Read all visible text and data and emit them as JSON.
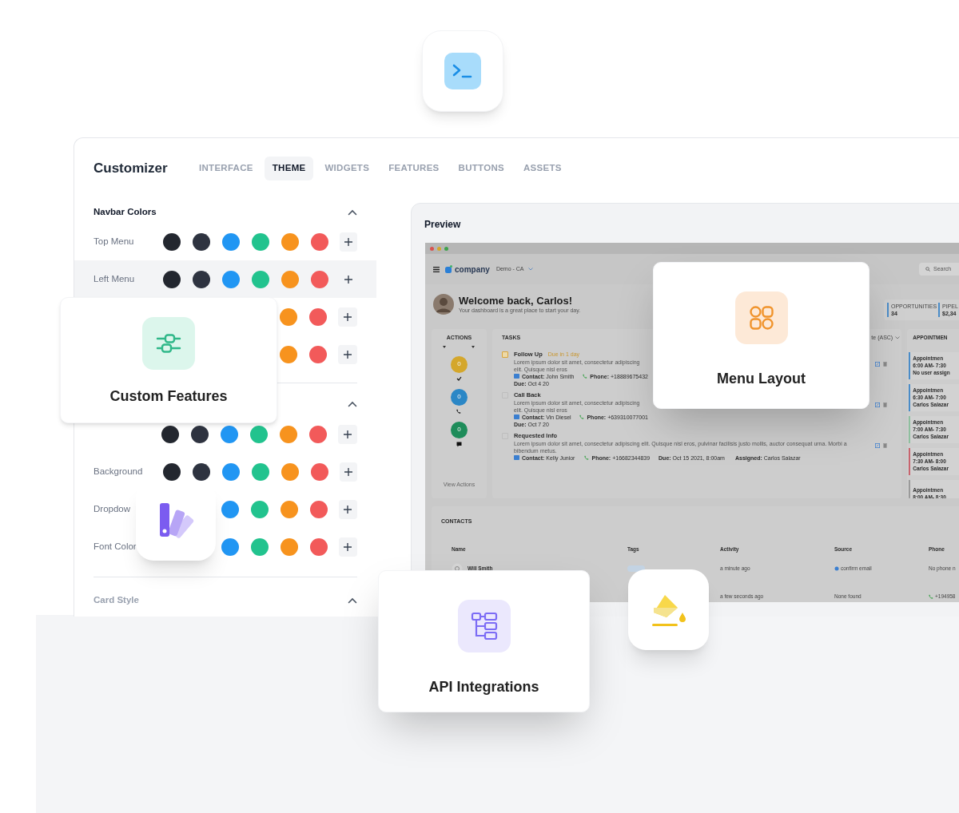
{
  "customizer": {
    "title": "Customizer",
    "tabs": [
      {
        "label": "INTERFACE",
        "selected": false
      },
      {
        "label": "THEME",
        "selected": true
      },
      {
        "label": "WIDGETS",
        "selected": false
      },
      {
        "label": "FEATURES",
        "selected": false
      },
      {
        "label": "BUTTONS",
        "selected": false
      },
      {
        "label": "ASSETS",
        "selected": false
      }
    ]
  },
  "sections": [
    {
      "title": "Navbar Colors",
      "expanded": true,
      "rows": [
        {
          "label": "Top Menu",
          "selected": false,
          "swatches": [
            {
              "color": "#23272f"
            },
            {
              "color": "#2e3340"
            },
            {
              "color": "#2196f3"
            },
            {
              "color": "#22c38e"
            },
            {
              "color": "#f7931e"
            },
            {
              "color": "#f25a5a"
            }
          ]
        },
        {
          "label": "Left Menu",
          "selected": true,
          "swatches": [
            {
              "color": "#23272f"
            },
            {
              "color": "#2e3340"
            },
            {
              "color": "#2196f3"
            },
            {
              "color": "#22c38e"
            },
            {
              "color": "#f7931e"
            },
            {
              "color": "#f25a5a"
            }
          ]
        },
        {
          "selected": false,
          "swatches": [
            {
              "color": "#f7931e"
            },
            {
              "color": "#f25a5a"
            }
          ]
        },
        {
          "selected": false,
          "swatches": [
            {
              "color": "#f7931e"
            },
            {
              "color": "#f25a5a"
            }
          ]
        }
      ]
    },
    {
      "expanded": true,
      "rows": [
        {
          "selected": false,
          "swatches": [
            {
              "color": "#23272f"
            },
            {
              "color": "#2e3340"
            },
            {
              "color": "#2196f3"
            },
            {
              "color": "#22c38e"
            },
            {
              "color": "#f7931e"
            },
            {
              "color": "#f25a5a"
            }
          ]
        },
        {
          "label": "Background",
          "selected": false,
          "swatches": [
            {
              "color": "#23272f"
            },
            {
              "color": "#2e3340"
            },
            {
              "color": "#2196f3"
            },
            {
              "color": "#22c38e"
            },
            {
              "color": "#f7931e"
            },
            {
              "color": "#f25a5a"
            }
          ]
        },
        {
          "label": "Dropdow",
          "selected": false,
          "swatches": [
            {
              "color": "#2196f3"
            },
            {
              "color": "#22c38e"
            },
            {
              "color": "#f7931e"
            },
            {
              "color": "#f25a5a"
            }
          ]
        },
        {
          "label": "Font Color",
          "selected": false,
          "swatches": [
            {
              "color": "#2196f3"
            },
            {
              "color": "#22c38e"
            },
            {
              "color": "#f7931e"
            },
            {
              "color": "#f25a5a"
            }
          ]
        }
      ]
    },
    {
      "title": "Card Style",
      "expanded": true
    }
  ],
  "preview": {
    "title": "Preview",
    "dashboard": {
      "brand": "company",
      "workspace": "Demo - CA",
      "search_placeholder": "Search",
      "greeting": "Welcome back, Carlos!",
      "subtitle": "Your dashboard is a great place to start your day.",
      "stats": [
        {
          "label": "OPPORTUNITIES",
          "value": "34"
        },
        {
          "label": "PIPEL",
          "value": "$2,34"
        }
      ],
      "actions": {
        "title": "ACTIONS",
        "items": [
          {
            "count": "0",
            "color": "#d4a72c",
            "kind": "done"
          },
          {
            "count": "0",
            "color": "#2b87c6",
            "kind": "call"
          },
          {
            "count": "0",
            "color": "#1e8c5a",
            "kind": "message"
          }
        ],
        "link": "View Actions"
      },
      "tasks": {
        "title": "TASKS",
        "sort": "te (ASC)",
        "items": [
          {
            "title": "Follow Up",
            "badge": "Due in 1 day",
            "urgent": true,
            "description": "Lorem ipsum dolor sit amet, consectetur adipiscing elit. Quisque nisl eros",
            "contact": "**Contact:** John Smith",
            "phone": "**Phone:** +18889675432",
            "due": "**Due:** Oct 4 20"
          },
          {
            "title": "Call Back",
            "urgent": false,
            "description": "Lorem ipsum dolor sit amet, consectetur adipiscing elit. Quisque nisl eros",
            "contact": "**Contact:** Vin Diesel",
            "phone": "**Phone:** +639310077001",
            "due": "**Due:** Oct 7 20"
          },
          {
            "title": "Requested Info",
            "urgent": false,
            "description": "Lorem ipsum dolor sit amet, consectetur adipiscing elit. Quisque nisl eros, pulvinar facilisis justo mollis, auctor consequat urna. Morbi a bibendum metus.",
            "contact": "**Contact:** Kelly Junior",
            "phone": "**Phone:** +16682344839",
            "due": "**Due:** Oct 15 2021, 8:00am",
            "assigned": "**Assigned:** Carlos Salazar"
          }
        ]
      },
      "appointments": {
        "title": "APPOINTMEN",
        "items": [
          {
            "title": "Appointmen",
            "time": "6:00 AM- 7:30",
            "assignee": "No user assign",
            "color": "#4a8cc8"
          },
          {
            "title": "Appointmen",
            "time": "6:30 AM- 7:00",
            "assignee": "Carlos Salazar",
            "color": "#4a8cc8"
          },
          {
            "title": "Appointmen",
            "time": "7:00 AM- 7:30",
            "assignee": "Carlos Salazar",
            "color": "#8fbf9f"
          },
          {
            "title": "Appointmen",
            "time": "7:30 AM- 8:00",
            "assignee": "Carlos Salazar",
            "color": "#c8646e"
          },
          {
            "title": "Appointmen",
            "time": "8:00 AM- 8:30",
            "color": "#9a9a9a"
          }
        ]
      },
      "contacts": {
        "title": "CONTACTS",
        "columns": [
          "Name",
          "Tags",
          "Activity",
          "Source",
          "Phone"
        ],
        "rows": [
          {
            "name": "Will Smith",
            "tagged": true,
            "activity": "a minute ago",
            "source": "confirm email",
            "source_icon": true,
            "phone": "No phone n",
            "phone_icon": false
          },
          {
            "tagged": false,
            "activity": "a few seconds ago",
            "source": "None found",
            "source_icon": false,
            "phone": "+194958",
            "phone_icon": true
          }
        ]
      }
    }
  },
  "feature_cards": [
    {
      "title": "Custom Features",
      "kind": "sliders"
    },
    {
      "title": "Menu Layout",
      "kind": "grid"
    },
    {
      "title": "API Integrations",
      "kind": "tree"
    }
  ]
}
